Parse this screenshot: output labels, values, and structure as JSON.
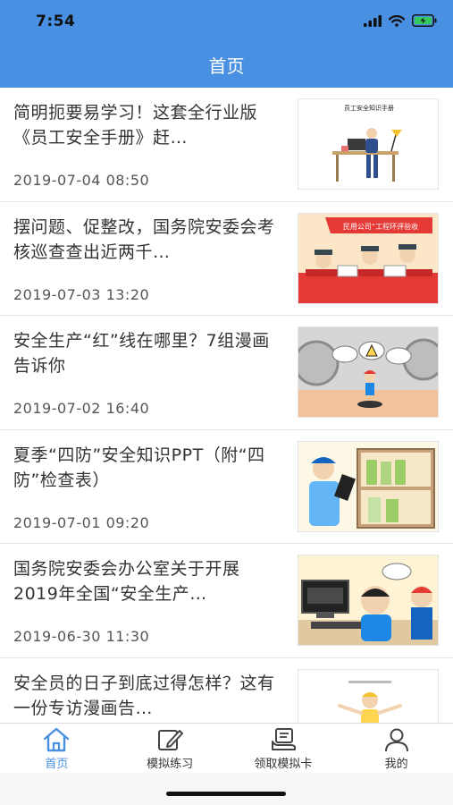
{
  "status_bar": {
    "time": "7:54"
  },
  "header": {
    "title": "首页"
  },
  "articles": [
    {
      "title": "简明扼要易学习！这套全行业版《员工安全手册》赶…",
      "date": "2019-07-04 08:50",
      "thumb_caption": "员工安全知识手册"
    },
    {
      "title": "摆问题、促整改，国务院安委会考核巡查查出近两千…",
      "date": "2019-07-03 13:20",
      "thumb_caption": "民用公司“工程环评验收"
    },
    {
      "title": "安全生产“红”线在哪里？7组漫画告诉你",
      "date": "2019-07-02 16:40"
    },
    {
      "title": "夏季“四防”安全知识PPT（附“四防”检查表）",
      "date": "2019-07-01 09:20"
    },
    {
      "title": "国务院安委会办公室关于开展2019年全国“安全生产…",
      "date": "2019-06-30 11:30"
    },
    {
      "title": "安全员的日子到底过得怎样？这有一份专访漫画告…",
      "date": ""
    }
  ],
  "tabbar": {
    "tabs": [
      {
        "label": "首页",
        "icon": "home-icon",
        "active": true
      },
      {
        "label": "模拟练习",
        "icon": "edit-icon",
        "active": false
      },
      {
        "label": "领取模拟卡",
        "icon": "card-stack-icon",
        "active": false
      },
      {
        "label": "我的",
        "icon": "user-icon",
        "active": false
      }
    ]
  },
  "colors": {
    "accent": "#4a90e2",
    "battery": "#34c759"
  }
}
